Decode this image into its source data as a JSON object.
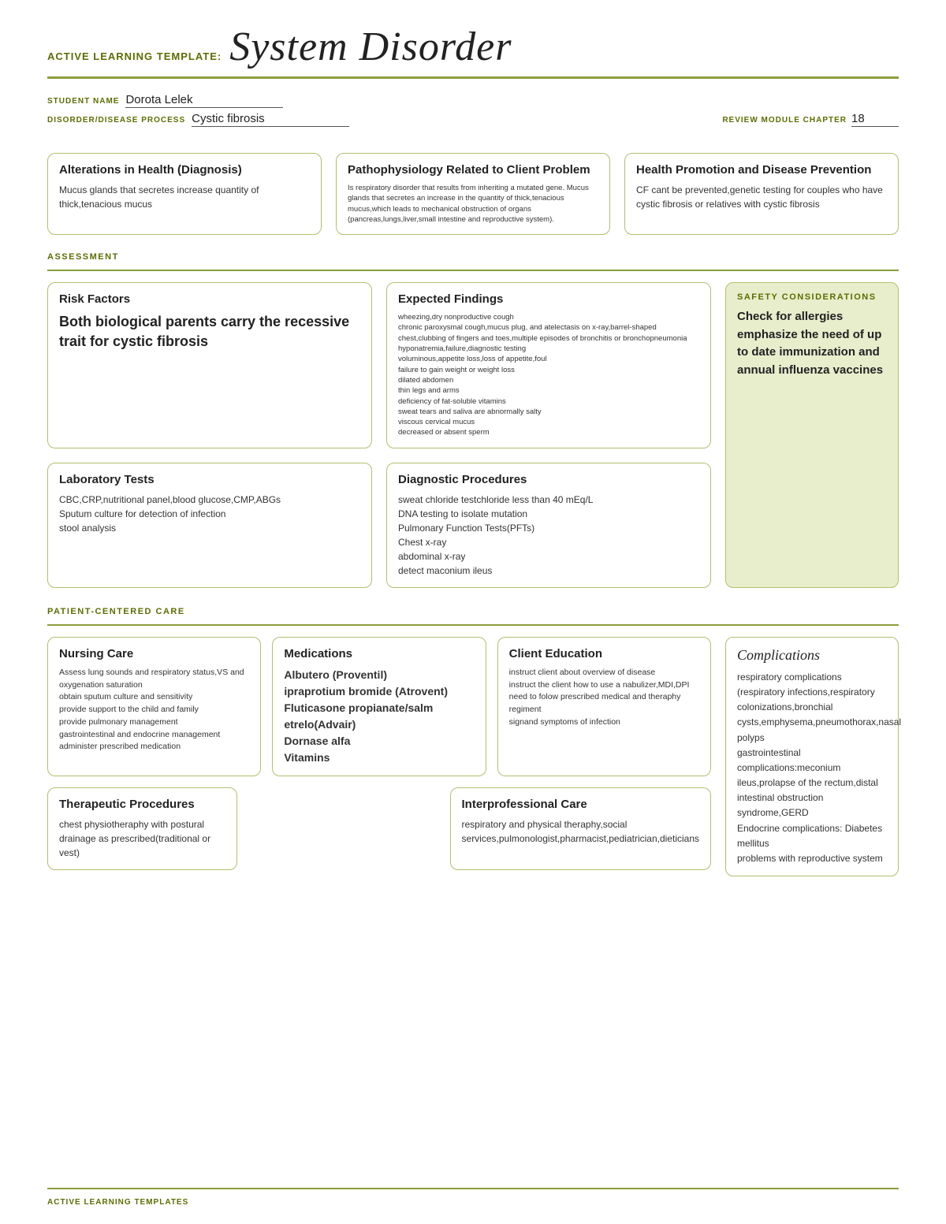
{
  "header": {
    "label": "ACTIVE LEARNING TEMPLATE:",
    "title": "System Disorder"
  },
  "student": {
    "name_label": "STUDENT NAME",
    "name_value": "Dorota Lelek",
    "disorder_label": "DISORDER/DISEASE PROCESS",
    "disorder_value": "Cystic fibrosis",
    "review_label": "REVIEW MODULE CHAPTER",
    "review_value": "18"
  },
  "top_cards": [
    {
      "title": "Alterations in Health (Diagnosis)",
      "body": "Mucus glands that secretes increase quantity of thick,tenacious mucus"
    },
    {
      "title": "Pathophysiology Related to Client Problem",
      "body": "Is respiratory disorder that results from inheriting a mutated gene. Mucus glands that secretes an increase in the quantity of thick,tenacious mucus,which leads to mechanical obstruction of organs (pancreas,lungs,liver,small intestine and reproductive system)."
    },
    {
      "title": "Health Promotion and Disease Prevention",
      "body": "CF cant be prevented,genetic testing for couples who have cystic fibrosis or relatives with cystic fibrosis"
    }
  ],
  "assessment_label": "ASSESSMENT",
  "risk_factors": {
    "title": "Risk Factors",
    "body": "Both biological parents carry the recessive trait for cystic fibrosis"
  },
  "expected_findings": {
    "title": "Expected Findings",
    "body": "wheezing,dry nonproductive cough\nchronic paroxysmal cough,mucus plug, and atelectasis on x-ray,barrel-shaped chest,clubbing of fingers and toes,multiple episodes of bronchitis or bronchopneumonia\nhyponatremia,failure,diagnostic testing\nvoluminous,appetite loss,loss of appetite,foul\nfailure to gain weight or weight loss\ndilated abdomen\nthin legs and arms\ndeficiency of fat-soluble vitamins\nsweat tears and saliva are abnormally salty\nviscous cervical mucus\ndecreased or absent sperm"
  },
  "lab_tests": {
    "title": "Laboratory Tests",
    "body": "CBC,CRP,nutritional panel,blood glucose,CMP,ABGs\nSputum culture for detection of infection\nstool analysis"
  },
  "diagnostic_procedures": {
    "title": "Diagnostic Procedures",
    "body": "sweat chloride testchloride less than 40 mEq/L\nDNA testing to isolate mutation\nPulmonary Function Tests(PFTs)\nChest x-ray\nabdominal x-ray\ndetect maconium ileus"
  },
  "safety": {
    "title": "SAFETY CONSIDERATIONS",
    "body": "Check for allergies emphasize the need of up to date immunization and annual influenza vaccines"
  },
  "pcc_label": "PATIENT-CENTERED CARE",
  "nursing_care": {
    "title": "Nursing Care",
    "body": "Assess lung sounds and respiratory status,VS and oxygenation saturation\nobtain sputum culture and sensitivity\nprovide support to the child and family\nprovide pulmonary management\ngastrointestinal and endocrine management\nadminister prescribed medication"
  },
  "medications": {
    "title": "Medications",
    "body": "Albutero (Proventil)\nipraprotium bromide (Atrovent)\nFluticasone propianate/salm etrelo(Advair)\nDornase alfa\nVitamins"
  },
  "client_education": {
    "title": "Client Education",
    "body": "instruct client about overview of disease\ninstruct the client how to use a nabulizer,MDI,DPI\nneed to folow prescribed medical and theraphy regiment\nsignand symptoms of infection"
  },
  "therapeutic": {
    "title": "Therapeutic Procedures",
    "body": "chest physiotheraphy with postural drainage as prescribed(traditional or vest)"
  },
  "interprofessional": {
    "title": "Interprofessional Care",
    "body": "respiratory and physical theraphy,social services,pulmonologist,pharmacist,pediatrician,dieticians"
  },
  "complications": {
    "title": "Complications",
    "body": "respiratory complications (respiratory infections,respiratory colonizations,bronchial cysts,emphysema,pneumothorax,nasal polyps\ngastrointestinal complications:meconium ileus,prolapse of the rectum,distal intestinal obstruction syndrome,GERD\nEndocrine complications: Diabetes mellitus\nproblems with reproductive system"
  },
  "footer": {
    "text": "ACTIVE LEARNING TEMPLATES"
  }
}
